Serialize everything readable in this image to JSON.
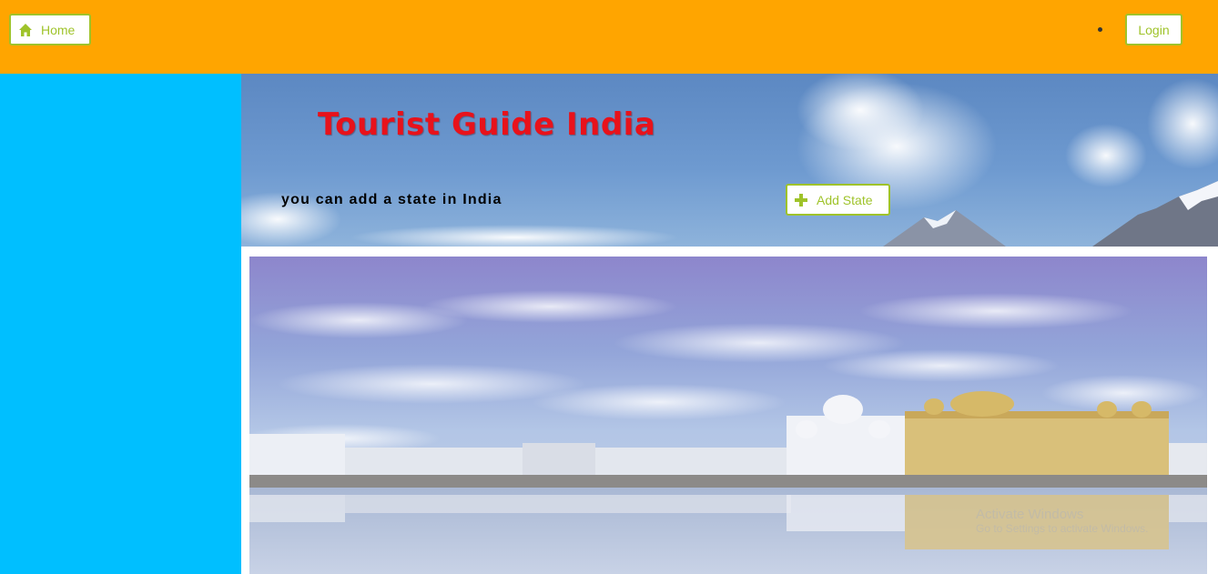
{
  "navbar": {
    "home_label": "Home",
    "login_label": "Login",
    "home_icon": "home-icon",
    "background_color": "#ffa500",
    "button_accent": "#9fc32a"
  },
  "sidebar": {
    "background_color": "#00bfff"
  },
  "hero": {
    "title": "Tourist Guide India",
    "title_color": "#e8121b",
    "subtitle": "you can add a state in India",
    "add_state_label": "Add State",
    "add_icon": "plus-icon"
  },
  "main_image": {
    "subject": "golden-temple-panorama"
  },
  "watermark": {
    "line1": "Activate Windows",
    "line2": "Go to Settings to activate Windows."
  }
}
